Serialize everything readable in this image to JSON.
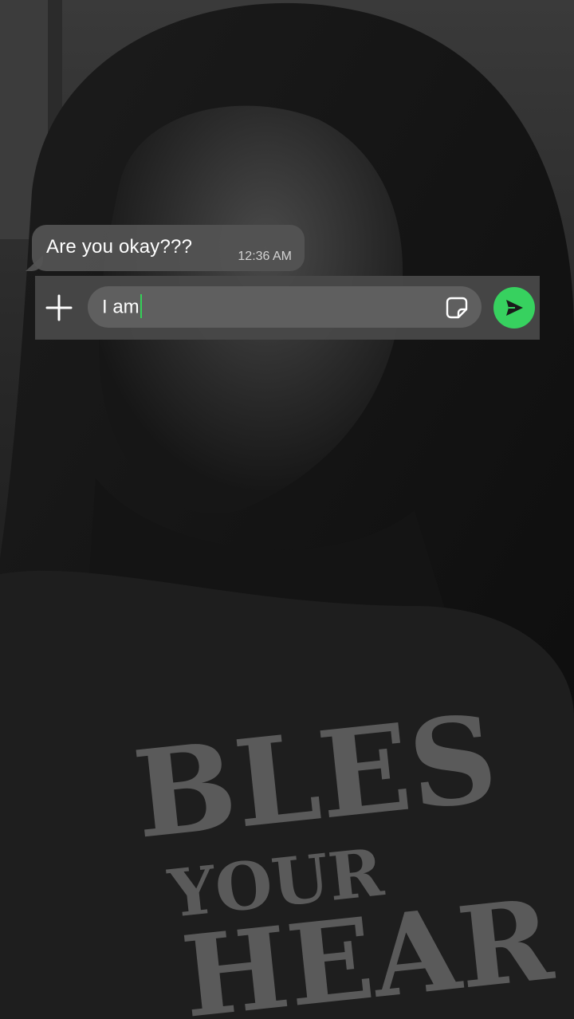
{
  "background": {
    "shirt_print": [
      "BLES",
      "YOUR",
      "HEAR"
    ]
  },
  "message": {
    "text": "Are you okay???",
    "time": "12:36 AM"
  },
  "composer": {
    "input_value": "I am",
    "accent_color": "#37d15f",
    "icons": {
      "add": "plus-icon",
      "sticker": "sticker-icon",
      "send": "send-arrow-icon"
    }
  }
}
